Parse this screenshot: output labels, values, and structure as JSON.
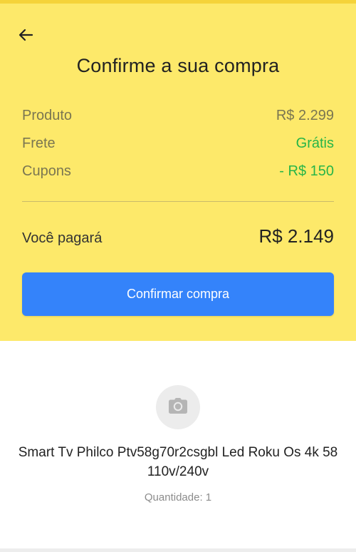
{
  "colors": {
    "header_background": "#fde96a",
    "top_strip": "#f5d33a",
    "accent_button": "#3483fa",
    "discount_green": "#27b548",
    "secondary_text": "#7a7651"
  },
  "header": {
    "back_icon": "arrow-left-icon",
    "title": "Confirme a sua compra"
  },
  "summary": {
    "items": [
      {
        "label": "Produto",
        "value": "R$ 2.299",
        "highlight": false
      },
      {
        "label": "Frete",
        "value": "Grátis",
        "highlight": true
      },
      {
        "label": "Cupons",
        "value": "- R$ 150",
        "highlight": true
      }
    ],
    "total_label": "Você pagará",
    "total_value": "R$ 2.149"
  },
  "actions": {
    "confirm_label": "Confirmar compra"
  },
  "product": {
    "image_icon": "camera-icon",
    "name": "Smart Tv Philco Ptv58g70r2csgbl Led Roku Os 4k 58  110v/240v",
    "quantity": "Quantidade: 1"
  }
}
